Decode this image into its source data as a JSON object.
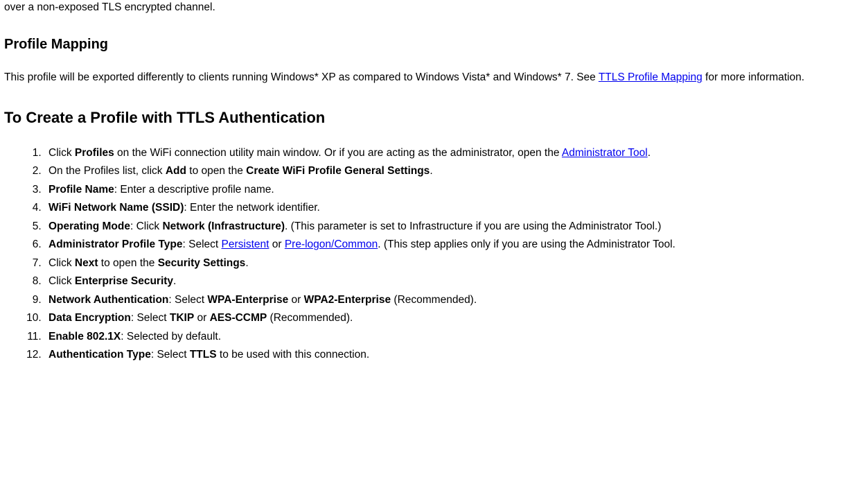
{
  "intro": "over a non-exposed TLS encrypted channel.",
  "section_profile_mapping": {
    "heading": "Profile Mapping",
    "para_pre": "This profile will be exported differently to clients running Windows* XP as compared to Windows Vista* and Windows* 7. See ",
    "link": "TTLS Profile Mapping",
    "para_post": " for more information."
  },
  "section_create": {
    "heading": "To Create a Profile with TTLS Authentication",
    "steps": {
      "s1_pre": "Click ",
      "s1_b1": "Profiles",
      "s1_mid": " on the WiFi connection utility main window. Or if you are acting as the administrator, open the ",
      "s1_link": "Administrator Tool",
      "s1_post": ".",
      "s2_pre": "On the Profiles list, click ",
      "s2_b1": "Add",
      "s2_mid": " to open the ",
      "s2_b2": "Create WiFi Profile General Settings",
      "s2_post": ".",
      "s3_b": "Profile Name",
      "s3_post": ": Enter a descriptive profile name.",
      "s4_b": "WiFi Network Name (SSID)",
      "s4_post": ": Enter the network identifier.",
      "s5_b1": "Operating Mode",
      "s5_mid": ": Click ",
      "s5_b2": "Network (Infrastructure)",
      "s5_post": ". (This parameter is set to Infrastructure if you are using the Administrator Tool.)",
      "s6_b1": "Administrator Profile Type",
      "s6_mid": ": Select ",
      "s6_link1": "Persistent",
      "s6_or": " or ",
      "s6_link2": "Pre-logon/Common",
      "s6_post": ". (This step applies only if you are using the Administrator Tool.",
      "s7_pre": "Click ",
      "s7_b1": "Next",
      "s7_mid": " to open the ",
      "s7_b2": "Security Settings",
      "s7_post": ".",
      "s8_pre": "Click ",
      "s8_b": "Enterprise Security",
      "s8_post": ".",
      "s9_b1": "Network Authentication",
      "s9_mid": ": Select ",
      "s9_b2": "WPA-Enterprise",
      "s9_or": " or ",
      "s9_b3": "WPA2-Enterprise",
      "s9_post": " (Recommended).",
      "s10_b1": "Data Encryption",
      "s10_mid": ": Select ",
      "s10_b2": "TKIP",
      "s10_or": " or ",
      "s10_b3": "AES-CCMP",
      "s10_post": " (Recommended).",
      "s11_b": "Enable 802.1X",
      "s11_post": ": Selected by default.",
      "s12_b1": "Authentication Type",
      "s12_mid": ": Select ",
      "s12_b2": "TTLS",
      "s12_post": " to be used with this connection."
    }
  }
}
